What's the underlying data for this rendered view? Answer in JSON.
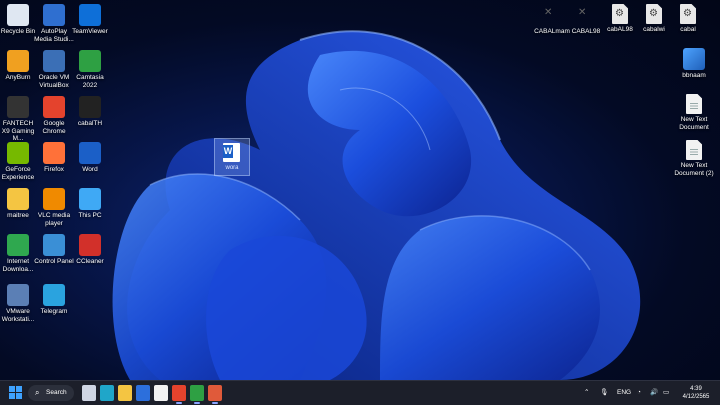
{
  "desktop_left": [
    {
      "name": "recycle-bin-icon",
      "label": "Recycle Bin",
      "color": "#dfe7f2"
    },
    {
      "name": "autoplay-icon",
      "label": "AutoPlay Media Studi...",
      "color": "#2f6fd0"
    },
    {
      "name": "teamviewer-icon",
      "label": "TeamViewer",
      "color": "#0e6fd8"
    },
    {
      "name": "anyburn-icon",
      "label": "AnyBurn",
      "color": "#f0a020"
    },
    {
      "name": "virtualbox-icon",
      "label": "Oracle VM VirtualBox",
      "color": "#3b6fb6"
    },
    {
      "name": "camtasia-icon",
      "label": "Camtasia 2022",
      "color": "#2ea043"
    },
    {
      "name": "mouse-icon",
      "label": "FANTECH X9 Gaming M...",
      "color": "#333333"
    },
    {
      "name": "chrome-icon",
      "label": "Google Chrome",
      "color": "#e4432d"
    },
    {
      "name": "cabalth-icon",
      "label": "cabalTH",
      "color": "#222222"
    },
    {
      "name": "geforce-icon",
      "label": "GeForce Experience",
      "color": "#76b900"
    },
    {
      "name": "firefox-icon",
      "label": "Firefox",
      "color": "#ff7139"
    },
    {
      "name": "word-icon",
      "label": "Word",
      "color": "#1b5fc7"
    },
    {
      "name": "folder-icon",
      "label": "maitree",
      "color": "#f4c542"
    },
    {
      "name": "vlc-icon",
      "label": "VLC media player",
      "color": "#f08a00"
    },
    {
      "name": "this-pc-icon",
      "label": "This PC",
      "color": "#3fa9f5"
    },
    {
      "name": "ie-icon",
      "label": "Internet Downloa...",
      "color": "#2fa84f"
    },
    {
      "name": "control-panel-icon",
      "label": "Control Panel",
      "color": "#3a8fd6"
    },
    {
      "name": "ccleaner-icon",
      "label": "CCleaner",
      "color": "#d2302a"
    },
    {
      "name": "vmware-icon",
      "label": "VMware Workstati...",
      "color": "#5b7fb5"
    },
    {
      "name": "telegram-icon",
      "label": "Telegram",
      "color": "#2aa3df"
    }
  ],
  "desktop_right_top": [
    {
      "name": "cabalmam-file-icon",
      "label": "CABALmam",
      "kind": "xfile"
    },
    {
      "name": "cabal98-file-icon",
      "label": "CABAL98",
      "kind": "xfile"
    },
    {
      "name": "cabal98-config-icon",
      "label": "cabAL98",
      "kind": "gear"
    },
    {
      "name": "cabalwi-config-icon",
      "label": "cabalwi",
      "kind": "gear"
    },
    {
      "name": "cabal-config-icon",
      "label": "cabal",
      "kind": "gear"
    }
  ],
  "desktop_right_col": [
    {
      "name": "bbnaam-icon",
      "label": "bbnaam",
      "kind": "app"
    },
    {
      "name": "new-text-document-icon",
      "label": "New Text Document",
      "kind": "file"
    },
    {
      "name": "new-text-document-2-icon",
      "label": "New Text Document (2)",
      "kind": "file"
    }
  ],
  "dragged_item": {
    "label": "wora"
  },
  "taskbar": {
    "search_label": "Search",
    "language": "ENG",
    "time": "4:39",
    "date": "4/12/2565",
    "apps": [
      {
        "name": "task-view-icon",
        "color": "#cfd6e4",
        "active": false
      },
      {
        "name": "edge-icon",
        "color": "#1fa6c9",
        "active": false
      },
      {
        "name": "file-explorer-icon",
        "color": "#f4c542",
        "active": false
      },
      {
        "name": "store-icon",
        "color": "#2c6fdc",
        "active": false
      },
      {
        "name": "notion-icon",
        "color": "#f2f2f2",
        "active": false
      },
      {
        "name": "chrome-taskbar-icon",
        "color": "#e4432d",
        "active": true
      },
      {
        "name": "camtasia-taskbar-icon",
        "color": "#2ea043",
        "active": true
      },
      {
        "name": "recorder-taskbar-icon",
        "color": "#e05a3a",
        "active": true
      }
    ]
  }
}
